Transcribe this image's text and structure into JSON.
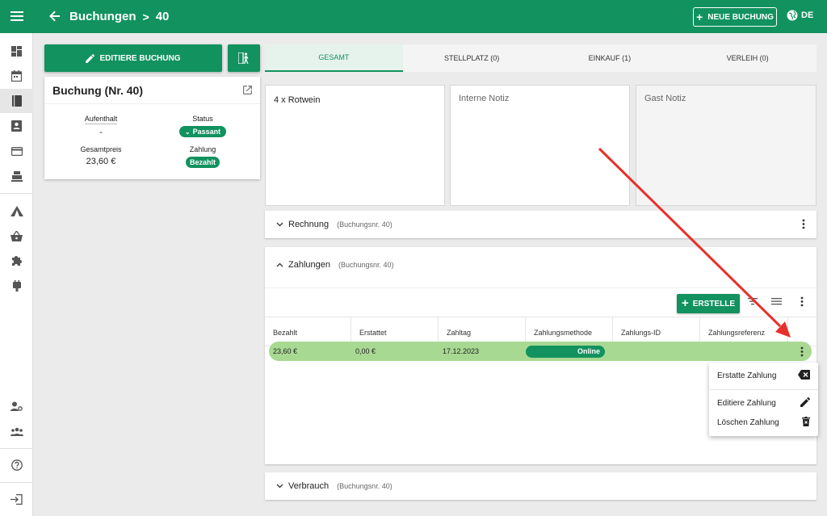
{
  "header": {
    "breadcrumb_parent": "Buchungen",
    "breadcrumb_sep": ">",
    "breadcrumb_current": "40",
    "new_booking_label": "NEUE BUCHUNG",
    "lang_label": "DE"
  },
  "sidebar": {
    "items": [
      {
        "icon": "dashboard-icon"
      },
      {
        "icon": "calendar-icon"
      },
      {
        "icon": "book-icon"
      },
      {
        "icon": "contact-book-icon"
      },
      {
        "icon": "credit-card-icon"
      },
      {
        "icon": "register-icon"
      },
      {
        "icon": "tent-icon"
      },
      {
        "icon": "basket-icon"
      },
      {
        "icon": "puzzle-icon"
      },
      {
        "icon": "power-plug-icon"
      },
      {
        "icon": "user-settings-icon"
      },
      {
        "icon": "group-icon"
      },
      {
        "icon": "help-icon"
      },
      {
        "icon": "logout-icon"
      }
    ]
  },
  "booking": {
    "edit_label": "EDITIERE BUCHUNG",
    "title": "Buchung (Nr. 40)",
    "aufenthalt_label": "Aufenthalt",
    "aufenthalt_value": "-",
    "status_label": "Status",
    "status_value": "Passant",
    "gesamtpreis_label": "Gesamtpreis",
    "gesamtpreis_value": "23,60 €",
    "zahlung_label": "Zahlung",
    "zahlung_value": "Bezahlt"
  },
  "tabs": [
    "GESAMT",
    "STELLPLATZ (0)",
    "EINKAUF (1)",
    "VERLEIH (0)"
  ],
  "notes": {
    "items_text": "4 x Rotwein",
    "internal_placeholder": "Interne Notiz",
    "guest_placeholder": "Gast Notiz"
  },
  "rechnung": {
    "title": "Rechnung",
    "sub": "(Buchungsnr. 40)"
  },
  "zahlungen": {
    "title": "Zahlungen",
    "sub": "(Buchungsnr. 40)",
    "create_label": "ERSTELLE",
    "columns": [
      "Bezahlt",
      "Erstattet",
      "Zahltag",
      "Zahlungsmethode",
      "Zahlungs-ID",
      "Zahlungsreferenz"
    ],
    "rows": [
      {
        "bezahlt": "23,60 €",
        "erstattet": "0,00 €",
        "zahltag": "17.12.2023",
        "methode": "Online",
        "id": "",
        "referenz": ""
      }
    ]
  },
  "verbrauch": {
    "title": "Verbrauch",
    "sub": "(Buchungsnr. 40)"
  },
  "context_menu": {
    "refund": "Erstatte Zahlung",
    "edit": "Editiere Zahlung",
    "delete": "Löschen Zahlung"
  },
  "colors": {
    "primary": "#12925f",
    "row_highlight": "#a8d992",
    "arrow": "#e8302a"
  }
}
